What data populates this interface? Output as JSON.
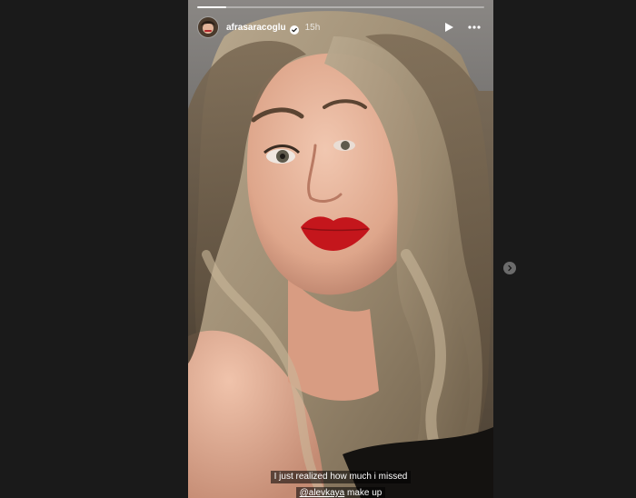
{
  "story": {
    "username": "afrasaracoglu",
    "timestamp": "15h",
    "progress": 0.1,
    "caption": {
      "line1": "I just realized how much i missed",
      "mention": "@alevkaya",
      "line2_suffix": " make up"
    }
  },
  "icons": {
    "verified": "verified-badge-icon",
    "play": "play-icon",
    "more": "more-horizontal-icon",
    "next": "chevron-right-icon"
  },
  "colors": {
    "page_background": "#1a1a1a",
    "lips": "#c4161c",
    "verified": "#3897f0"
  }
}
